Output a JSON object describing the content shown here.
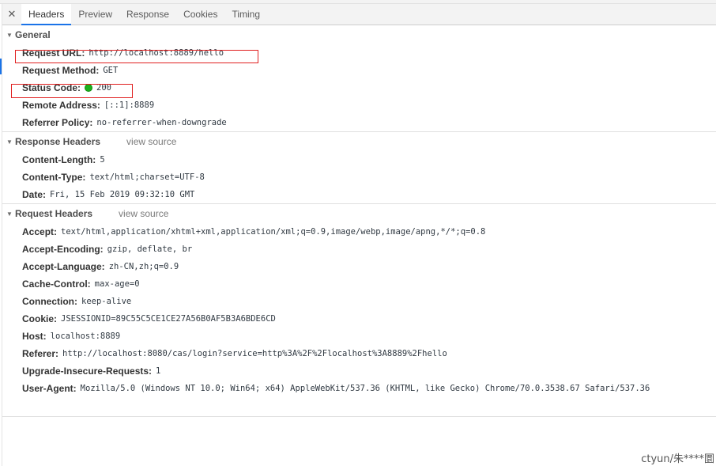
{
  "tabs": {
    "close": "✕",
    "items": [
      {
        "label": "Headers",
        "active": true
      },
      {
        "label": "Preview",
        "active": false
      },
      {
        "label": "Response",
        "active": false
      },
      {
        "label": "Cookies",
        "active": false
      },
      {
        "label": "Timing",
        "active": false
      }
    ]
  },
  "general": {
    "title": "General",
    "request_url_label": "Request URL:",
    "request_url": "http://localhost:8889/hello",
    "request_method_label": "Request Method:",
    "request_method": "GET",
    "status_code_label": "Status Code:",
    "status_code": "200",
    "status_color": "#1bb11b",
    "remote_address_label": "Remote Address:",
    "remote_address": "[::1]:8889",
    "referrer_policy_label": "Referrer Policy:",
    "referrer_policy": "no-referrer-when-downgrade"
  },
  "response_headers": {
    "title": "Response Headers",
    "view_source": "view source",
    "rows": [
      {
        "key": "Content-Length:",
        "value": "5"
      },
      {
        "key": "Content-Type:",
        "value": "text/html;charset=UTF-8"
      },
      {
        "key": "Date:",
        "value": "Fri, 15 Feb 2019 09:32:10 GMT"
      }
    ]
  },
  "request_headers": {
    "title": "Request Headers",
    "view_source": "view source",
    "rows": [
      {
        "key": "Accept:",
        "value": "text/html,application/xhtml+xml,application/xml;q=0.9,image/webp,image/apng,*/*;q=0.8"
      },
      {
        "key": "Accept-Encoding:",
        "value": "gzip, deflate, br"
      },
      {
        "key": "Accept-Language:",
        "value": "zh-CN,zh;q=0.9"
      },
      {
        "key": "Cache-Control:",
        "value": "max-age=0"
      },
      {
        "key": "Connection:",
        "value": "keep-alive"
      },
      {
        "key": "Cookie:",
        "value": "JSESSIONID=89C55C5CE1CE27A56B0AF5B3A6BDE6CD"
      },
      {
        "key": "Host:",
        "value": "localhost:8889"
      },
      {
        "key": "Referer:",
        "value": "http://localhost:8080/cas/login?service=http%3A%2F%2Flocalhost%3A8889%2Fhello"
      },
      {
        "key": "Upgrade-Insecure-Requests:",
        "value": "1"
      },
      {
        "key": "User-Agent:",
        "value": "Mozilla/5.0 (Windows NT 10.0; Win64; x64) AppleWebKit/537.36 (KHTML, like Gecko) Chrome/70.0.3538.67 Safari/537.36"
      }
    ]
  },
  "watermark": "ctyun/朱****圜",
  "colors": {
    "highlight": "#e02020",
    "accent": "#1a73e8"
  }
}
